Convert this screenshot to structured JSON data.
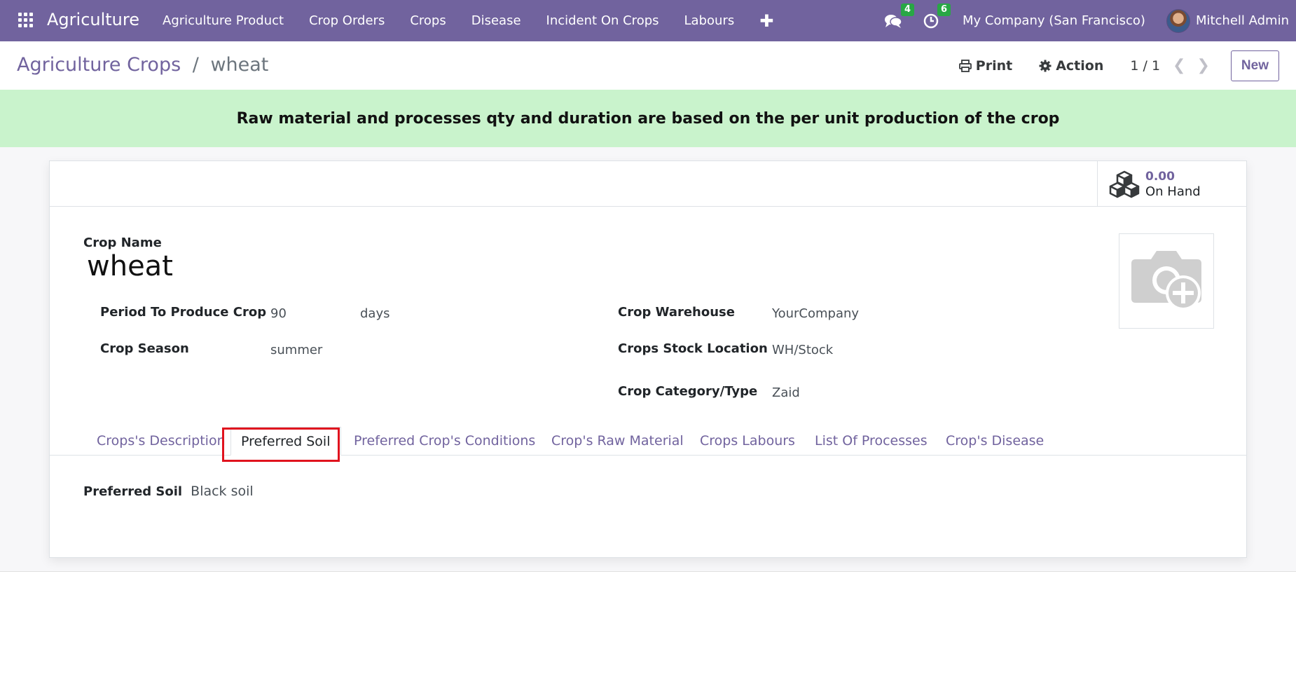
{
  "navbar": {
    "brand": "Agriculture",
    "menu": [
      "Agriculture Product",
      "Crop Orders",
      "Crops",
      "Disease",
      "Incident On Crops",
      "Labours"
    ],
    "messages_count": "4",
    "activities_count": "6",
    "company": "My Company (San Francisco)",
    "user": "Mitchell Admin"
  },
  "breadcrumb": {
    "parent": "Agriculture Crops",
    "separator": "/",
    "current": "wheat"
  },
  "control": {
    "print": "Print",
    "action": "Action",
    "pager": "1 / 1",
    "new": "New"
  },
  "alert": "Raw material and processes qty and duration are based on the per unit production of the crop",
  "stat": {
    "value": "0.00",
    "label": "On Hand"
  },
  "form": {
    "crop_name_label": "Crop Name",
    "crop_name": "wheat",
    "period_label": "Period To Produce Crop",
    "period_value": "90",
    "period_unit": "days",
    "season_label": "Crop Season",
    "season_value": "summer",
    "warehouse_label": "Crop Warehouse",
    "warehouse_value": "YourCompany",
    "location_label": "Crops Stock Location",
    "location_value": "WH/Stock",
    "category_label": "Crop Category/Type",
    "category_value": "Zaid"
  },
  "tabs": [
    "Crops's Description",
    "Preferred Soil",
    "Preferred Crop's Conditions",
    "Crop's Raw Material",
    "Crops Labours",
    "List Of Processes",
    "Crop's Disease"
  ],
  "active_tab": "Preferred Soil",
  "tab_content": {
    "label": "Preferred Soil",
    "value": "Black soil"
  },
  "colors": {
    "brand": "#71639e",
    "alert_bg": "#c9f3cc",
    "badge": "#28a745",
    "highlight": "#e0131e"
  },
  "icons": [
    "apps-grid-icon",
    "chat-icon",
    "clock-icon",
    "printer-icon",
    "gear-icon",
    "chevron-left-icon",
    "chevron-right-icon",
    "cubes-icon",
    "camera-plus-icon"
  ]
}
